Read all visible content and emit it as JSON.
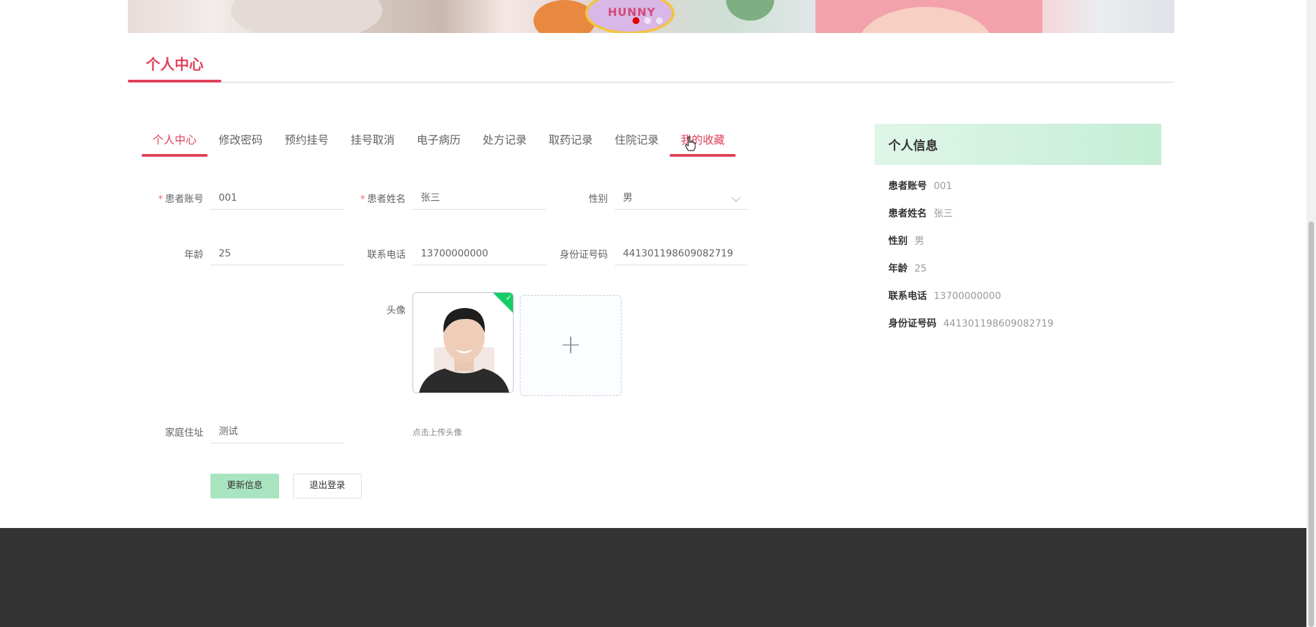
{
  "banner": {
    "text": "HUNNY",
    "dot_count": 3,
    "active_dot": 0
  },
  "section": {
    "title": "个人中心"
  },
  "tabs": [
    {
      "label": "个人中心",
      "active": true
    },
    {
      "label": "修改密码"
    },
    {
      "label": "预约挂号"
    },
    {
      "label": "挂号取消"
    },
    {
      "label": "电子病历"
    },
    {
      "label": "处方记录"
    },
    {
      "label": "取药记录"
    },
    {
      "label": "住院记录"
    },
    {
      "label": "我的收藏",
      "hover": true
    }
  ],
  "form": {
    "account": {
      "label": "患者账号",
      "value": "001",
      "required": true
    },
    "name": {
      "label": "患者姓名",
      "value": "张三",
      "required": true
    },
    "gender": {
      "label": "性别",
      "value": "男"
    },
    "age": {
      "label": "年龄",
      "value": "25"
    },
    "phone": {
      "label": "联系电话",
      "value": "13700000000"
    },
    "id_card": {
      "label": "身份证号码",
      "value": "441301198609082719"
    },
    "avatar": {
      "label": "头像",
      "upload_tip": "点击上传头像",
      "uploaded": true
    },
    "address": {
      "label": "家庭住址",
      "value": "测试"
    },
    "buttons": {
      "update": "更新信息",
      "logout": "退出登录"
    }
  },
  "info_card": {
    "title": "个人信息",
    "rows": [
      {
        "key": "患者账号",
        "value": "001"
      },
      {
        "key": "患者姓名",
        "value": "张三"
      },
      {
        "key": "性别",
        "value": "男"
      },
      {
        "key": "年龄",
        "value": "25"
      },
      {
        "key": "联系电话",
        "value": "13700000000"
      },
      {
        "key": "身份证号码",
        "value": "441301198609082719"
      }
    ]
  },
  "colors": {
    "accent": "#e0415a",
    "primary_button": "#a9e4c1",
    "card_header": "#c5edd6",
    "footer": "#333333"
  }
}
